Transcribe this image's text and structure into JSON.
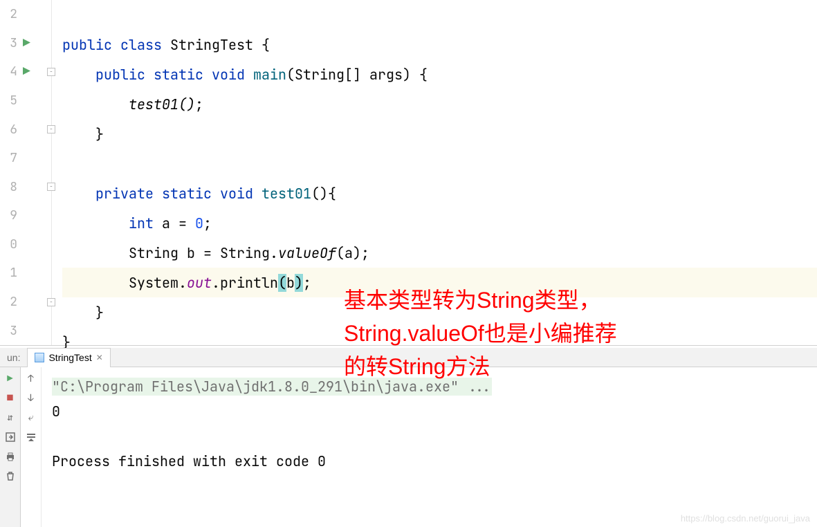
{
  "lineNumbers": [
    "2",
    "3",
    "4",
    "5",
    "6",
    "7",
    "8",
    "9",
    "0",
    "1",
    "2",
    "3"
  ],
  "code": {
    "l3": {
      "pre": "",
      "tokens": [
        {
          "t": "public ",
          "c": "kw"
        },
        {
          "t": "class ",
          "c": "kw"
        },
        {
          "t": "StringTest {",
          "c": "plain"
        }
      ]
    },
    "l4": {
      "pre": "    ",
      "tokens": [
        {
          "t": "public static void ",
          "c": "kw"
        },
        {
          "t": "main",
          "c": "method"
        },
        {
          "t": "(String[] args) {",
          "c": "plain"
        }
      ]
    },
    "l5": {
      "pre": "        ",
      "tokens": [
        {
          "t": "test01()",
          "c": "call-italic"
        },
        {
          "t": ";",
          "c": "plain"
        }
      ]
    },
    "l6": {
      "pre": "    ",
      "tokens": [
        {
          "t": "}",
          "c": "plain"
        }
      ]
    },
    "l7": {
      "pre": "",
      "tokens": []
    },
    "l8": {
      "pre": "    ",
      "tokens": [
        {
          "t": "private static void ",
          "c": "kw"
        },
        {
          "t": "test01",
          "c": "method"
        },
        {
          "t": "(){",
          "c": "plain"
        }
      ]
    },
    "l9": {
      "pre": "        ",
      "tokens": [
        {
          "t": "int ",
          "c": "kw"
        },
        {
          "t": "a = ",
          "c": "plain"
        },
        {
          "t": "0",
          "c": "num"
        },
        {
          "t": ";",
          "c": "plain"
        }
      ]
    },
    "l10": {
      "pre": "        ",
      "tokens": [
        {
          "t": "String b = String.",
          "c": "plain"
        },
        {
          "t": "valueOf",
          "c": "call-italic"
        },
        {
          "t": "(a);",
          "c": "plain"
        }
      ]
    },
    "l11": {
      "pre": "        ",
      "tokens": [
        {
          "t": "System.",
          "c": "plain"
        },
        {
          "t": "out",
          "c": "field-italic"
        },
        {
          "t": ".println",
          "c": "plain"
        },
        {
          "t": "(",
          "c": "paren-hl"
        },
        {
          "t": "b",
          "c": "plain"
        },
        {
          "t": ")",
          "c": "paren-hl"
        },
        {
          "t": ";",
          "c": "plain"
        }
      ]
    },
    "l12": {
      "pre": "    ",
      "tokens": [
        {
          "t": "}",
          "c": "plain"
        }
      ]
    },
    "l13": {
      "pre": "",
      "tokens": [
        {
          "t": "}",
          "c": "plain"
        }
      ]
    }
  },
  "annotation": {
    "line1": "基本类型转为String类型，",
    "line2": "String.valueOf也是小编推荐",
    "line3": "的转String方法"
  },
  "runPanel": {
    "label": "un:",
    "tabName": "StringTest",
    "command": "\"C:\\Program Files\\Java\\jdk1.8.0_291\\bin\\java.exe\" ...",
    "output": "0",
    "exitMsg": "Process finished with exit code 0"
  },
  "watermark": "https://blog.csdn.net/guorui_java"
}
